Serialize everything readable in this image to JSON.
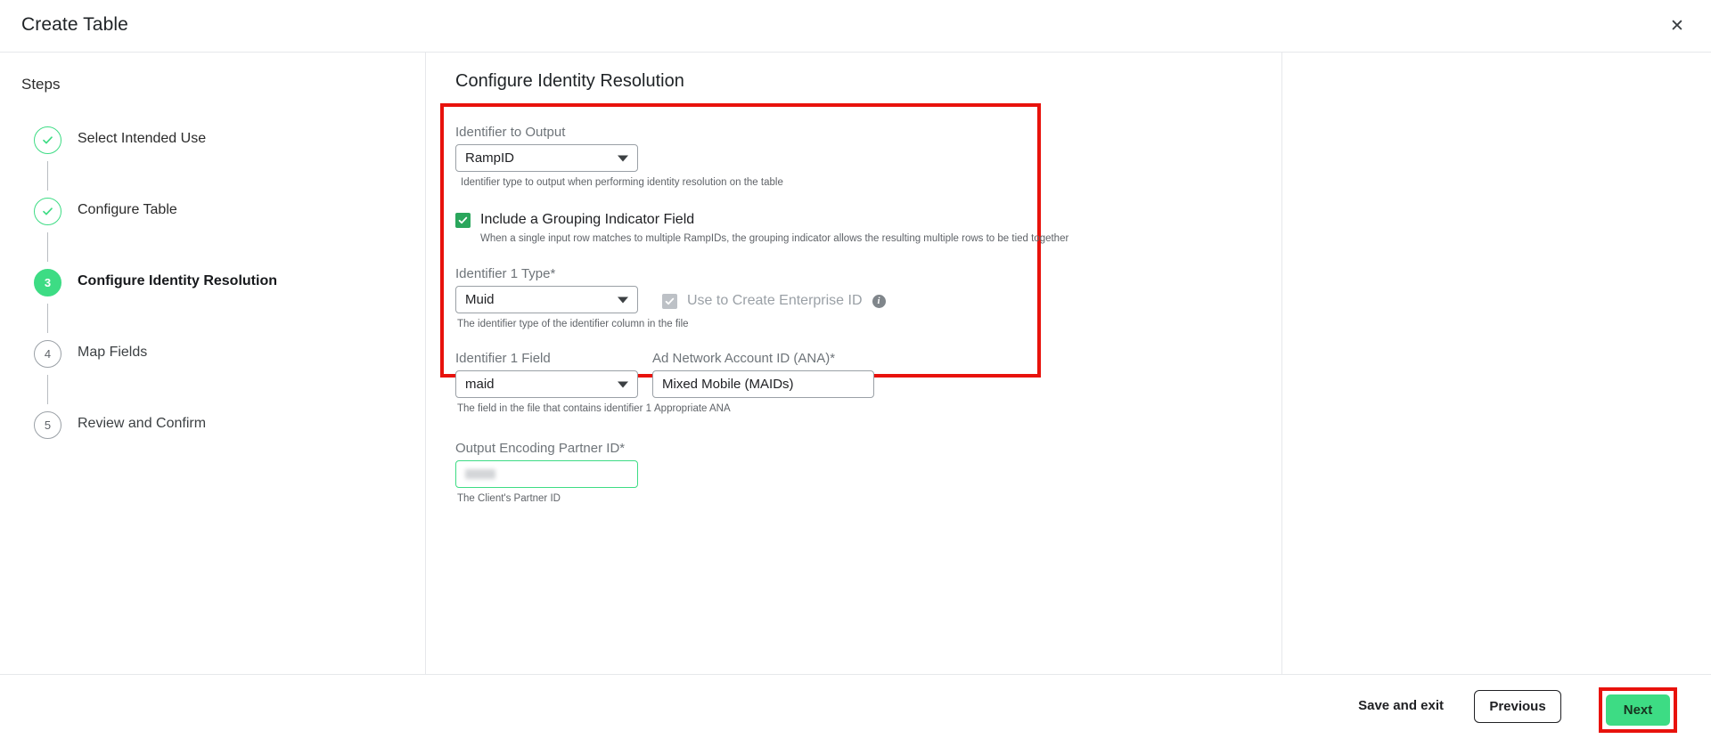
{
  "header": {
    "title": "Create Table",
    "close_label": "✕"
  },
  "steps": {
    "heading": "Steps",
    "items": [
      {
        "number": "1",
        "label": "Select Intended Use",
        "state": "done"
      },
      {
        "number": "2",
        "label": "Configure Table",
        "state": "done"
      },
      {
        "number": "3",
        "label": "Configure Identity Resolution",
        "state": "active"
      },
      {
        "number": "4",
        "label": "Map Fields",
        "state": "todo"
      },
      {
        "number": "5",
        "label": "Review and Confirm",
        "state": "todo"
      }
    ]
  },
  "main": {
    "section_title": "Configure Identity Resolution",
    "identifier_to_output": {
      "label": "Identifier to Output",
      "value": "RampID",
      "help": "Identifier type to output when performing identity resolution on the table"
    },
    "grouping_indicator": {
      "label": "Include a Grouping Indicator Field",
      "checked": true,
      "help": "When a single input row matches to multiple RampIDs, the grouping indicator allows the resulting multiple rows to be tied together"
    },
    "identifier_1_type": {
      "label": "Identifier 1 Type",
      "required_mark": "*",
      "value": "Muid",
      "help": "The identifier type of the identifier column in the file"
    },
    "enterprise_id": {
      "label": "Use to Create Enterprise ID",
      "checked": true,
      "disabled": true,
      "info_glyph": "i"
    },
    "identifier_1_field": {
      "label": "Identifier 1 Field",
      "value": "maid",
      "help": "The field in the file that contains identifier 1"
    },
    "ad_network_account_id": {
      "label": "Ad Network Account ID (ANA)",
      "required_mark": "*",
      "value": "Mixed Mobile (MAIDs)",
      "help": "Appropriate ANA"
    },
    "output_encoding_partner_id": {
      "label": "Output Encoding Partner ID",
      "required_mark": "*",
      "value": "",
      "redacted": true,
      "help": "The Client's Partner ID"
    }
  },
  "footer": {
    "save_and_exit": "Save and exit",
    "previous": "Previous",
    "next": "Next"
  },
  "colors": {
    "accent_green": "#3ddc84",
    "checkbox_green": "#2aa65c",
    "annotation_red": "#e8120c",
    "border_gray": "#9aa0a6",
    "divider": "#e6e8eb"
  }
}
